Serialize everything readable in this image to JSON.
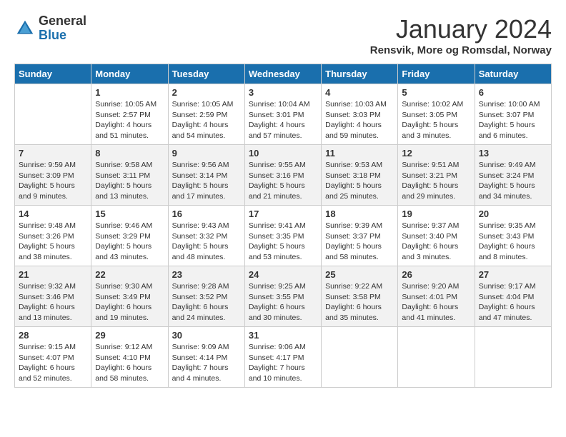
{
  "header": {
    "logo_general": "General",
    "logo_blue": "Blue",
    "month_title": "January 2024",
    "location": "Rensvik, More og Romsdal, Norway"
  },
  "days_of_week": [
    "Sunday",
    "Monday",
    "Tuesday",
    "Wednesday",
    "Thursday",
    "Friday",
    "Saturday"
  ],
  "weeks": [
    [
      {
        "day": "",
        "info": ""
      },
      {
        "day": "1",
        "info": "Sunrise: 10:05 AM\nSunset: 2:57 PM\nDaylight: 4 hours\nand 51 minutes."
      },
      {
        "day": "2",
        "info": "Sunrise: 10:05 AM\nSunset: 2:59 PM\nDaylight: 4 hours\nand 54 minutes."
      },
      {
        "day": "3",
        "info": "Sunrise: 10:04 AM\nSunset: 3:01 PM\nDaylight: 4 hours\nand 57 minutes."
      },
      {
        "day": "4",
        "info": "Sunrise: 10:03 AM\nSunset: 3:03 PM\nDaylight: 4 hours\nand 59 minutes."
      },
      {
        "day": "5",
        "info": "Sunrise: 10:02 AM\nSunset: 3:05 PM\nDaylight: 5 hours\nand 3 minutes."
      },
      {
        "day": "6",
        "info": "Sunrise: 10:00 AM\nSunset: 3:07 PM\nDaylight: 5 hours\nand 6 minutes."
      }
    ],
    [
      {
        "day": "7",
        "info": "Sunrise: 9:59 AM\nSunset: 3:09 PM\nDaylight: 5 hours\nand 9 minutes."
      },
      {
        "day": "8",
        "info": "Sunrise: 9:58 AM\nSunset: 3:11 PM\nDaylight: 5 hours\nand 13 minutes."
      },
      {
        "day": "9",
        "info": "Sunrise: 9:56 AM\nSunset: 3:14 PM\nDaylight: 5 hours\nand 17 minutes."
      },
      {
        "day": "10",
        "info": "Sunrise: 9:55 AM\nSunset: 3:16 PM\nDaylight: 5 hours\nand 21 minutes."
      },
      {
        "day": "11",
        "info": "Sunrise: 9:53 AM\nSunset: 3:18 PM\nDaylight: 5 hours\nand 25 minutes."
      },
      {
        "day": "12",
        "info": "Sunrise: 9:51 AM\nSunset: 3:21 PM\nDaylight: 5 hours\nand 29 minutes."
      },
      {
        "day": "13",
        "info": "Sunrise: 9:49 AM\nSunset: 3:24 PM\nDaylight: 5 hours\nand 34 minutes."
      }
    ],
    [
      {
        "day": "14",
        "info": "Sunrise: 9:48 AM\nSunset: 3:26 PM\nDaylight: 5 hours\nand 38 minutes."
      },
      {
        "day": "15",
        "info": "Sunrise: 9:46 AM\nSunset: 3:29 PM\nDaylight: 5 hours\nand 43 minutes."
      },
      {
        "day": "16",
        "info": "Sunrise: 9:43 AM\nSunset: 3:32 PM\nDaylight: 5 hours\nand 48 minutes."
      },
      {
        "day": "17",
        "info": "Sunrise: 9:41 AM\nSunset: 3:35 PM\nDaylight: 5 hours\nand 53 minutes."
      },
      {
        "day": "18",
        "info": "Sunrise: 9:39 AM\nSunset: 3:37 PM\nDaylight: 5 hours\nand 58 minutes."
      },
      {
        "day": "19",
        "info": "Sunrise: 9:37 AM\nSunset: 3:40 PM\nDaylight: 6 hours\nand 3 minutes."
      },
      {
        "day": "20",
        "info": "Sunrise: 9:35 AM\nSunset: 3:43 PM\nDaylight: 6 hours\nand 8 minutes."
      }
    ],
    [
      {
        "day": "21",
        "info": "Sunrise: 9:32 AM\nSunset: 3:46 PM\nDaylight: 6 hours\nand 13 minutes."
      },
      {
        "day": "22",
        "info": "Sunrise: 9:30 AM\nSunset: 3:49 PM\nDaylight: 6 hours\nand 19 minutes."
      },
      {
        "day": "23",
        "info": "Sunrise: 9:28 AM\nSunset: 3:52 PM\nDaylight: 6 hours\nand 24 minutes."
      },
      {
        "day": "24",
        "info": "Sunrise: 9:25 AM\nSunset: 3:55 PM\nDaylight: 6 hours\nand 30 minutes."
      },
      {
        "day": "25",
        "info": "Sunrise: 9:22 AM\nSunset: 3:58 PM\nDaylight: 6 hours\nand 35 minutes."
      },
      {
        "day": "26",
        "info": "Sunrise: 9:20 AM\nSunset: 4:01 PM\nDaylight: 6 hours\nand 41 minutes."
      },
      {
        "day": "27",
        "info": "Sunrise: 9:17 AM\nSunset: 4:04 PM\nDaylight: 6 hours\nand 47 minutes."
      }
    ],
    [
      {
        "day": "28",
        "info": "Sunrise: 9:15 AM\nSunset: 4:07 PM\nDaylight: 6 hours\nand 52 minutes."
      },
      {
        "day": "29",
        "info": "Sunrise: 9:12 AM\nSunset: 4:10 PM\nDaylight: 6 hours\nand 58 minutes."
      },
      {
        "day": "30",
        "info": "Sunrise: 9:09 AM\nSunset: 4:14 PM\nDaylight: 7 hours\nand 4 minutes."
      },
      {
        "day": "31",
        "info": "Sunrise: 9:06 AM\nSunset: 4:17 PM\nDaylight: 7 hours\nand 10 minutes."
      },
      {
        "day": "",
        "info": ""
      },
      {
        "day": "",
        "info": ""
      },
      {
        "day": "",
        "info": ""
      }
    ]
  ]
}
